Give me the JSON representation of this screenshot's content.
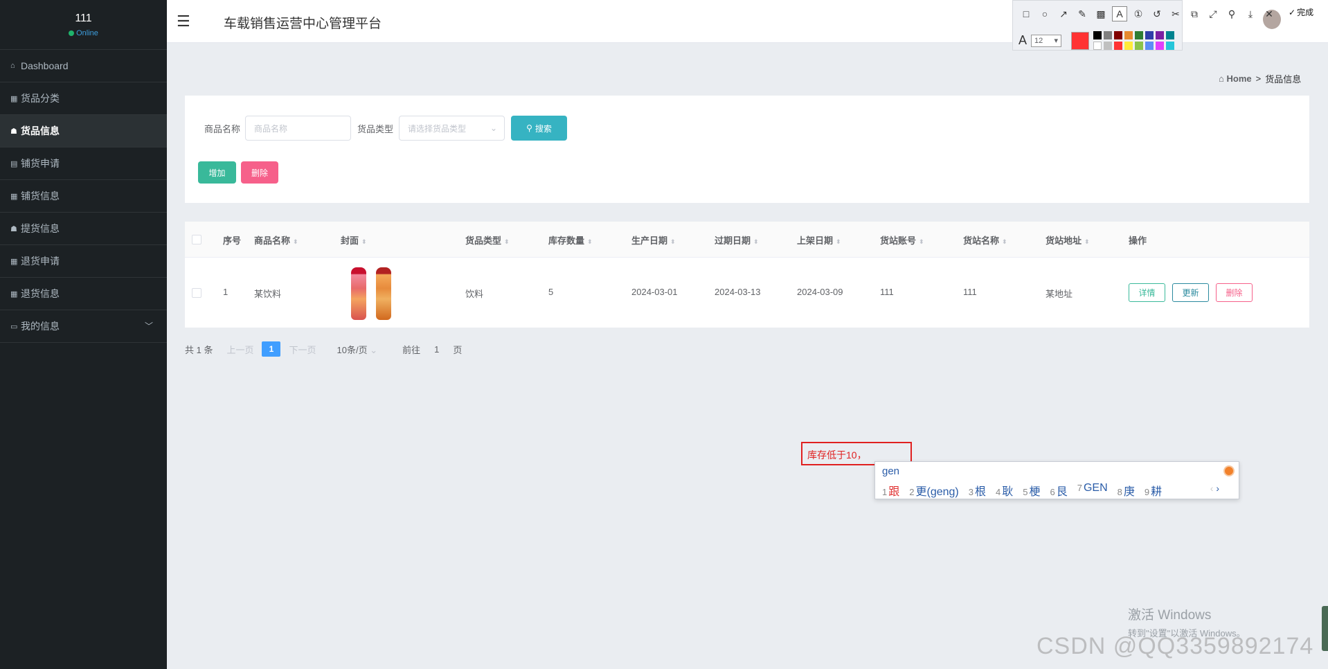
{
  "sidebar": {
    "username": "111",
    "status": "Online",
    "items": [
      {
        "icon": "home-icon",
        "glyph": "⌂",
        "label": "Dashboard"
      },
      {
        "icon": "grid-icon",
        "glyph": "▦",
        "label": "货品分类"
      },
      {
        "icon": "goods-icon",
        "glyph": "☗",
        "label": "货品信息"
      },
      {
        "icon": "apply-icon",
        "glyph": "▤",
        "label": "铺货申请"
      },
      {
        "icon": "grid-icon",
        "glyph": "▦",
        "label": "铺货信息"
      },
      {
        "icon": "lock-icon",
        "glyph": "☗",
        "label": "提货信息"
      },
      {
        "icon": "grid-icon",
        "glyph": "▦",
        "label": "退货申请"
      },
      {
        "icon": "grid-icon",
        "glyph": "▦",
        "label": "退货信息"
      },
      {
        "icon": "card-icon",
        "glyph": "▭",
        "label": "我的信息"
      }
    ]
  },
  "header": {
    "title": "车载销售运营中心管理平台"
  },
  "screenshot_tool": {
    "done_label": "完成",
    "font_size": "12",
    "current_color": "#ff3333"
  },
  "breadcrumb": {
    "home": "Home",
    "separator": ">",
    "current": "货品信息"
  },
  "search": {
    "name_label": "商品名称",
    "name_placeholder": "商品名称",
    "type_label": "货品类型",
    "type_placeholder": "请选择货品类型",
    "search_button": "搜索",
    "add_button": "增加",
    "delete_button": "删除"
  },
  "table": {
    "columns": [
      "序号",
      "商品名称",
      "封面",
      "货品类型",
      "库存数量",
      "生产日期",
      "过期日期",
      "上架日期",
      "货站账号",
      "货站名称",
      "货站地址",
      "操作"
    ],
    "rows": [
      {
        "index": "1",
        "name": "某饮料",
        "type": "饮料",
        "stock": "5",
        "produced": "2024-03-01",
        "expires": "2024-03-13",
        "listed": "2024-03-09",
        "station_account": "111",
        "station_name": "111",
        "station_address": "某地址"
      }
    ],
    "actions": {
      "detail": "详情",
      "update": "更新",
      "delete": "删除"
    }
  },
  "pagination": {
    "total": "共 1 条",
    "prev": "上一页",
    "current": "1",
    "next": "下一页",
    "page_size": "10条/页",
    "goto_label": "前往",
    "goto_value": "1",
    "goto_suffix": "页"
  },
  "annotation": {
    "text": "库存低于10，"
  },
  "ime": {
    "composition": "gen",
    "candidates": [
      {
        "n": "1",
        "c": "跟"
      },
      {
        "n": "2",
        "c": "更(geng)"
      },
      {
        "n": "3",
        "c": "根"
      },
      {
        "n": "4",
        "c": "耿"
      },
      {
        "n": "5",
        "c": "梗"
      },
      {
        "n": "6",
        "c": "艮"
      },
      {
        "n": "7",
        "c": "GEN"
      },
      {
        "n": "8",
        "c": "庚"
      },
      {
        "n": "9",
        "c": "耕"
      }
    ]
  },
  "windows_activation": {
    "line1": "激活 Windows",
    "line2": "转到\"设置\"以激活 Windows。"
  },
  "watermark": "CSDN @QQ3359892174",
  "colors": {
    "teal": "#36b3c2",
    "green": "#39b99a",
    "pink": "#f6608a",
    "blue": "#409eff",
    "sidebar": "#1c2124"
  }
}
